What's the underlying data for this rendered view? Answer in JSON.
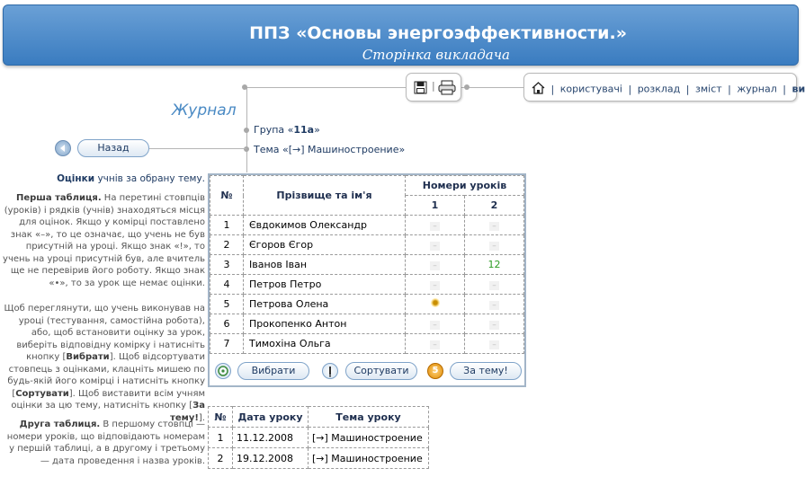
{
  "header": {
    "title": "ППЗ «Основы энергоэффективности.»",
    "subtitle": "Сторінка викладача"
  },
  "toolbar": {
    "save_icon": "save-icon",
    "print_icon": "print-icon"
  },
  "nav": {
    "home_icon": "home-icon",
    "items": [
      "користувачі",
      "розклад",
      "зміст",
      "журнал",
      "вихід"
    ]
  },
  "journal": {
    "title": "Журнал",
    "group_prefix": "Група «",
    "group_name": "11а",
    "group_suffix": "»",
    "topic": "Тема «[→] Машиностроение»",
    "back_label": "Назад"
  },
  "help": {
    "lead_bold": "Оцінки",
    "lead_rest": " учнів за обрану тему.",
    "p1_bold": "Перша таблиця.",
    "p1_text": " На перетині стовпців (уроків) і рядків (учнів) знаходяться місця для оцінок. Якщо у комірці поставлено знак «–», то це означає, що учень не був присутній на уроці. Якщо знак «!», то учень на уроці присутній був, але вчитель ще не перевірив його роботу. Якщо знак «•», то за урок ще немає оцінки.",
    "p2_text_a": "Щоб переглянути, що учень виконував на уроці (тестування, самостійна робота), або, щоб встановити оцінку за урок, виберіть відповідну комірку і натисніть кнопку [",
    "p2_btn1": "Вибрати",
    "p2_text_b": "]. Щоб відсортувати стовпець з оцінками, клацніть мишею по будь-якій його комірці і натисніть кнопку [",
    "p2_btn2": "Сортувати",
    "p2_text_c": "]. Щоб виставити всім учням оцінки за цю тему, натисніть кнопку [",
    "p2_btn3": "За тему!",
    "p2_text_d": "].",
    "p3_bold": "Друга таблиця.",
    "p3_text": " В першому стовпці — номери уроків, що відповідають номерам у першій таблиці, а в другому і третьому — дата проведення і назва уроків."
  },
  "grades": {
    "col_num": "№",
    "col_name": "Прізвище та ім'я",
    "col_lessons": "Номери уроків",
    "lessons": [
      "1",
      "2"
    ],
    "rows": [
      {
        "num": "1",
        "name": "Євдокимов Олександр",
        "g1": "–",
        "g2": "–"
      },
      {
        "num": "2",
        "name": "Єгоров Єгор",
        "g1": "–",
        "g2": "–"
      },
      {
        "num": "3",
        "name": "Іванов Іван",
        "g1": "–",
        "g2": "12"
      },
      {
        "num": "4",
        "name": "Петров Петро",
        "g1": "–",
        "g2": "–"
      },
      {
        "num": "5",
        "name": "Петрова Олена",
        "g1": "•",
        "g2": "–"
      },
      {
        "num": "6",
        "name": "Прокопенко Антон",
        "g1": "–",
        "g2": "–"
      },
      {
        "num": "7",
        "name": "Тимохіна Ольга",
        "g1": "–",
        "g2": "–"
      }
    ],
    "buttons": {
      "select": "Вибрати",
      "sort": "Сортувати",
      "topic": "За тему!",
      "topic_badge": "5"
    }
  },
  "lessons_table": {
    "col_num": "№",
    "col_date": "Дата уроку",
    "col_topic": "Тема уроку",
    "rows": [
      {
        "num": "1",
        "date": "11.12.2008",
        "topic": "[→] Машиностроение"
      },
      {
        "num": "2",
        "date": "19.12.2008",
        "topic": "[→] Машиностроение"
      }
    ]
  }
}
